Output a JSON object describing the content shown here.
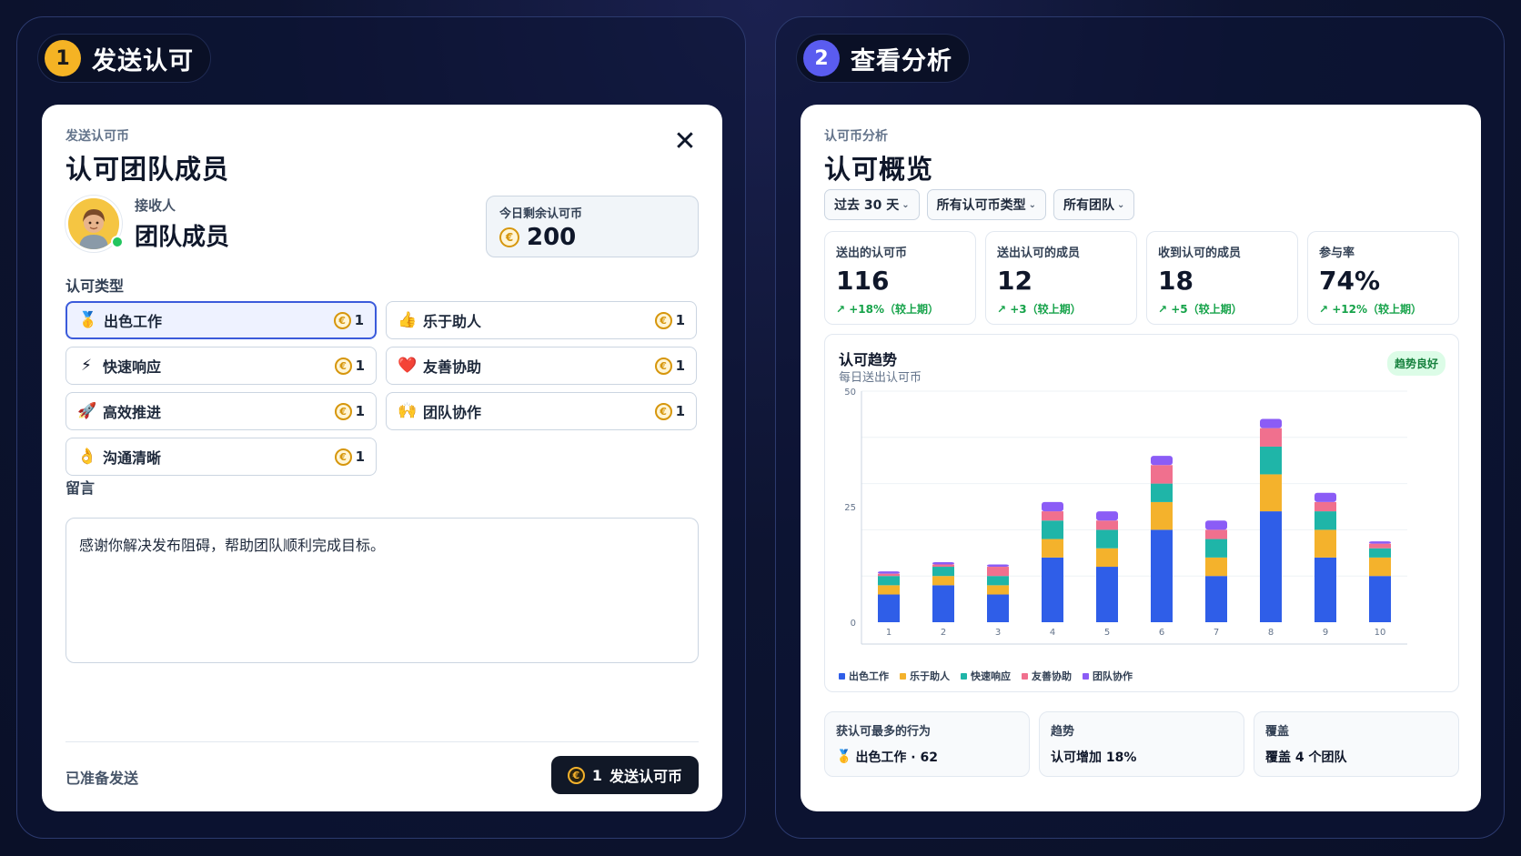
{
  "left": {
    "step_number": "1",
    "step_title": "发送认可",
    "eyebrow": "发送认可币",
    "title": "认可团队成员",
    "close_glyph": "✕",
    "recipient": {
      "label": "接收人",
      "name": "团队成员"
    },
    "balance": {
      "label": "今日剩余认可币",
      "value": "200",
      "coin_glyph": "€"
    },
    "types_label": "认可类型",
    "types": [
      {
        "emoji": "🥇",
        "label": "出色工作",
        "cost": "1",
        "selected": true
      },
      {
        "emoji": "👍",
        "label": "乐于助人",
        "cost": "1",
        "selected": false
      },
      {
        "emoji": "⚡",
        "label": "快速响应",
        "cost": "1",
        "selected": false
      },
      {
        "emoji": "❤️",
        "label": "友善协助",
        "cost": "1",
        "selected": false
      },
      {
        "emoji": "🚀",
        "label": "高效推进",
        "cost": "1",
        "selected": false
      },
      {
        "emoji": "🙌",
        "label": "团队协作",
        "cost": "1",
        "selected": false
      },
      {
        "emoji": "👌",
        "label": "沟通清晰",
        "cost": "1",
        "selected": false
      }
    ],
    "message_label": "留言",
    "message_value": "感谢你解决发布阻碍，帮助团队顺利完成目标。",
    "status": "已准备发送",
    "send": {
      "count": "1",
      "label": "发送认可币"
    }
  },
  "right": {
    "step_number": "2",
    "step_title": "查看分析",
    "eyebrow": "认可币分析",
    "title": "认可概览",
    "filters": [
      {
        "label": "过去 30 天"
      },
      {
        "label": "所有认可币类型"
      },
      {
        "label": "所有团队"
      }
    ],
    "stats": [
      {
        "label": "送出的认可币",
        "value": "116",
        "delta": "↗ +18%（较上期）"
      },
      {
        "label": "送出认可的成员",
        "value": "12",
        "delta": "↗ +3（较上期）"
      },
      {
        "label": "收到认可的成员",
        "value": "18",
        "delta": "↗ +5（较上期）"
      },
      {
        "label": "参与率",
        "value": "74%",
        "delta": "↗ +12%（较上期）"
      }
    ],
    "chart_title": "认可趋势",
    "chart_subtitle": "每日送出认可币",
    "chart_badge": "趋势良好",
    "insights": [
      {
        "label": "获认可最多的行为",
        "emoji": "🥇",
        "value": "出色工作 · 62"
      },
      {
        "label": "趋势",
        "emoji": "",
        "value": "认可增加 18%"
      },
      {
        "label": "覆盖",
        "emoji": "",
        "value": "覆盖 4 个团队"
      }
    ]
  },
  "colors": {
    "series": [
      "#2f5ee8",
      "#f4b22c",
      "#1fb5a8",
      "#f0708e",
      "#8b5cf6"
    ]
  },
  "chart_data": {
    "type": "bar",
    "stacked": true,
    "categories": [
      "1",
      "2",
      "3",
      "4",
      "5",
      "6",
      "7",
      "8",
      "9",
      "10"
    ],
    "series": [
      {
        "name": "出色工作",
        "values": [
          6,
          8,
          6,
          14,
          12,
          20,
          10,
          24,
          14,
          10
        ]
      },
      {
        "name": "乐于助人",
        "values": [
          2,
          2,
          2,
          4,
          4,
          6,
          4,
          8,
          6,
          4
        ]
      },
      {
        "name": "快速响应",
        "values": [
          2,
          2,
          2,
          4,
          4,
          4,
          4,
          6,
          4,
          2
        ]
      },
      {
        "name": "友善协助",
        "values": [
          0.5,
          0.5,
          2,
          2,
          2,
          4,
          2,
          4,
          2,
          1
        ]
      },
      {
        "name": "团队协作",
        "values": [
          0.5,
          0.5,
          0.5,
          2,
          2,
          2,
          2,
          2,
          2,
          0.5
        ]
      }
    ],
    "ylim": [
      0,
      50
    ],
    "yticks": [
      0,
      25,
      50
    ],
    "grid": true,
    "legend": "bottom-left"
  }
}
